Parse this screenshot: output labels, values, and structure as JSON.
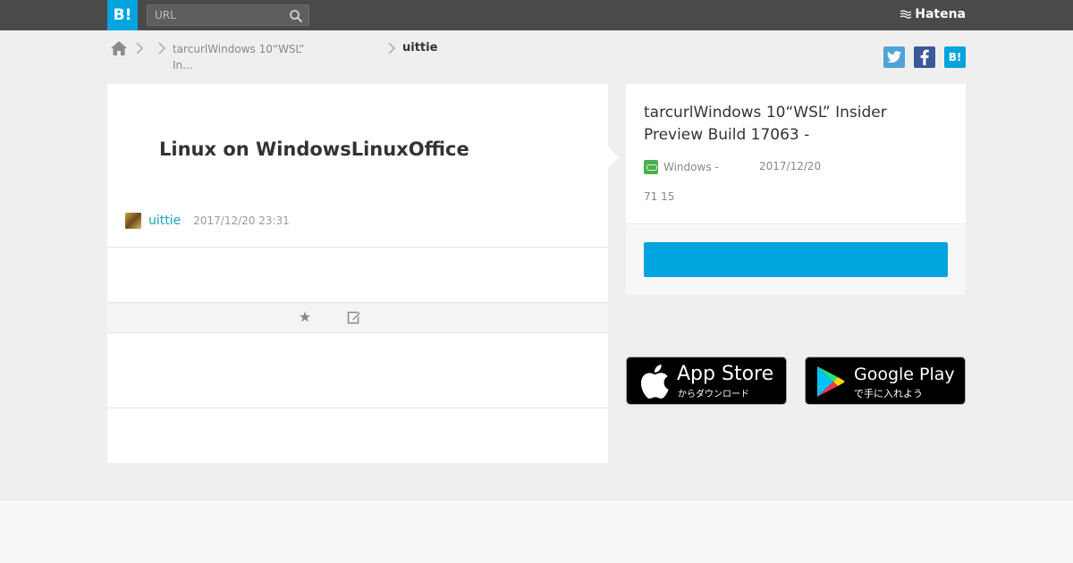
{
  "header": {
    "logo_label": "B!",
    "search_placeholder": "URL",
    "brand": "Hatena",
    "colors": {
      "bar": "#4a4a4a",
      "accent": "#00a4de"
    }
  },
  "breadcrumb": {
    "entry_label": "tarcurlWindows 10“WSL” In...",
    "user_label": "uittie"
  },
  "share": {
    "twitter": "twitter-icon",
    "facebook": "facebook-icon",
    "hatena_label": "B!"
  },
  "comment": {
    "title": "Linux on WindowsLinuxOffice",
    "user": "uittie",
    "datetime": "2017/12/20 23:31"
  },
  "entry": {
    "title": "tarcurlWindows 10“WSL” Insider Preview Build 17063 -",
    "site": "Windows -",
    "date": "2017/12/20",
    "counts": "71 15"
  },
  "badges": {
    "appstore_title": "App Store",
    "appstore_sub": "からダウンロード",
    "googleplay_title": "Google Play",
    "googleplay_sub": "で手に入れよう"
  }
}
